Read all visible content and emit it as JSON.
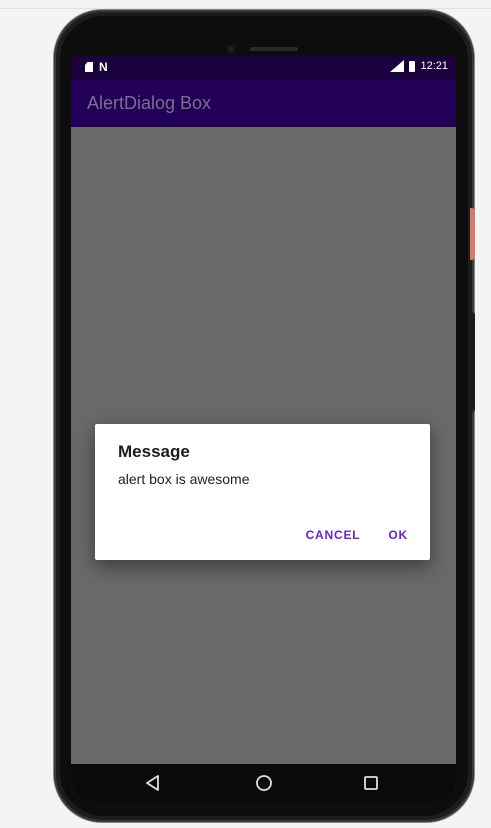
{
  "status_bar": {
    "carrier_icon": "notification-n-icon",
    "time": "12:21"
  },
  "app_bar": {
    "title": "AlertDialog Box"
  },
  "dialog": {
    "title": "Message",
    "message": "alert box is awesome",
    "cancel_label": "CANCEL",
    "ok_label": "OK"
  },
  "nav_bar": {
    "back_icon": "back-triangle-icon",
    "home_icon": "home-circle-icon",
    "recent_icon": "recents-square-icon"
  },
  "colors": {
    "status_bar": "#1b0040",
    "app_bar": "#220058",
    "scrim": "#696969",
    "accent": "#6a1fd8"
  }
}
